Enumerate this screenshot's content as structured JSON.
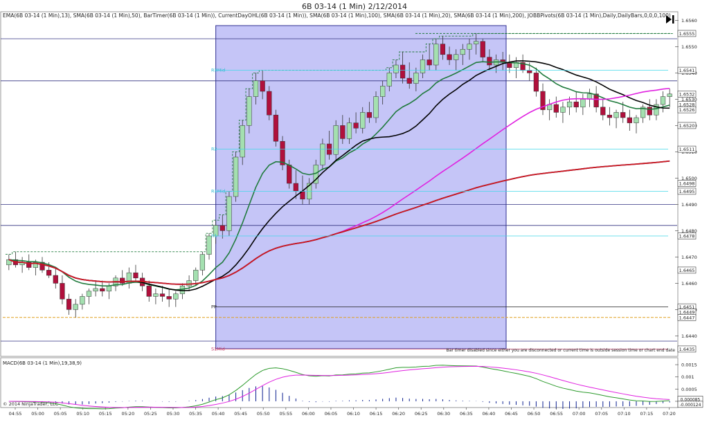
{
  "window": {
    "title": "6B 03-14 (1 Min)  2/12/2014"
  },
  "toolbar": {
    "play_icon": "skip-forward-icon"
  },
  "indicators_label": "EMA(6B 03-14 (1 Min),13), SMA(6B 03-14 (1 Min),50), BarTimer(6B 03-14 (1 Min)), CurrentDayOHL(6B 03-14 (1 Min)), SMA(6B 03-14 (1 Min),100), SMA(6B 03-14 (1 Min),20), SMA(6B 03-14 (1 Min),200), JOBBPivots(6B 03-14 (1 Min),Daily,DailyBars,0,0,0,100)",
  "bar_timer_message": "Bar timer disabled since either you are disconnected or current time is outside session time or chart end date",
  "copyright": "© 2014 NinjaTrader, LLC",
  "macd_label": "MACD(6B 03-14 (1 Min),19,38,9)",
  "colors": {
    "up_candle": "#a4e0b0",
    "down_candle": "#b0103c",
    "ema13": "#1f7a3c",
    "sma20": "#000000",
    "sma50": "#e020e0",
    "sma100": "#0a1ec8",
    "sma200": "#d01818",
    "pivot_line": "#40d8e8",
    "highlight": "#8c8cf0",
    "macd_line": "#2a9a2a",
    "macd_signal": "#e020e0",
    "macd_hist": "#0a1e90"
  },
  "chart_data": [
    {
      "type": "candlestick",
      "title": "6B 03-14 (1 Min)  2/12/2014",
      "x_ticks": [
        "04:55",
        "05:00",
        "05:05",
        "05:10",
        "05:15",
        "05:20",
        "05:25",
        "05:30",
        "05:35",
        "05:40",
        "05:45",
        "05:50",
        "05:55",
        "06:00",
        "06:05",
        "06:10",
        "06:15",
        "06:20",
        "06:25",
        "06:30",
        "06:35",
        "06:40",
        "06:45",
        "06:50",
        "06:55",
        "07:00",
        "07:05",
        "07:10",
        "07:15",
        "07:20"
      ],
      "y_ticks": [
        "1.6440",
        "1.6450",
        "1.6460",
        "1.6470",
        "1.6480",
        "1.6490",
        "1.6500",
        "1.6510",
        "1.6520",
        "1.6530",
        "1.6540",
        "1.6550",
        "1.6560"
      ],
      "ylim": [
        1.6433,
        1.6563
      ],
      "price_labels": [
        "1.6555",
        "1.6541",
        "1.6532",
        "1.6528",
        "1.6526",
        "1.6520",
        "1.6511",
        "1.6498",
        "1.6495",
        "1.6478",
        "1.6465",
        "1.6451",
        "1.6449",
        "1.6447",
        "1.6435"
      ],
      "pivot_levels": [
        {
          "name": "R3Mid",
          "value": 1.6541
        },
        {
          "name": "R2",
          "value": 1.6511
        },
        {
          "name": "R1Mid",
          "value": 1.6495
        },
        {
          "name": "R1",
          "value": 1.6478
        },
        {
          "name": "PP",
          "value": 1.6451
        },
        {
          "name": "S1Mid",
          "value": 1.6435
        }
      ],
      "session_high": 1.6555,
      "session_open": 1.6447,
      "series_names": [
        "EMA 13",
        "SMA 20",
        "SMA 50",
        "SMA 100",
        "SMA 200"
      ],
      "candles": [
        [
          1.6467,
          1.6471,
          1.6465,
          1.6469
        ],
        [
          1.6469,
          1.6472,
          1.6466,
          1.6467
        ],
        [
          1.6467,
          1.647,
          1.6464,
          1.6468
        ],
        [
          1.6468,
          1.6471,
          1.6465,
          1.6466
        ],
        [
          1.6466,
          1.6469,
          1.6463,
          1.6468
        ],
        [
          1.6468,
          1.647,
          1.6464,
          1.6465
        ],
        [
          1.6465,
          1.6468,
          1.6462,
          1.6463
        ],
        [
          1.6463,
          1.6466,
          1.6458,
          1.646
        ],
        [
          1.646,
          1.6463,
          1.6452,
          1.6454
        ],
        [
          1.6454,
          1.6456,
          1.6448,
          1.645
        ],
        [
          1.645,
          1.6454,
          1.6447,
          1.6452
        ],
        [
          1.6452,
          1.6456,
          1.645,
          1.6455
        ],
        [
          1.6455,
          1.6458,
          1.6452,
          1.6457
        ],
        [
          1.6457,
          1.6461,
          1.6455,
          1.6458
        ],
        [
          1.6458,
          1.6461,
          1.6455,
          1.6457
        ],
        [
          1.6457,
          1.646,
          1.6454,
          1.6459
        ],
        [
          1.6459,
          1.6463,
          1.6457,
          1.6462
        ],
        [
          1.6462,
          1.6465,
          1.6459,
          1.646
        ],
        [
          1.646,
          1.6466,
          1.6458,
          1.6464
        ],
        [
          1.6464,
          1.6467,
          1.6461,
          1.6462
        ],
        [
          1.6462,
          1.6464,
          1.6457,
          1.6459
        ],
        [
          1.6459,
          1.6461,
          1.6453,
          1.6455
        ],
        [
          1.6455,
          1.6458,
          1.6452,
          1.6456
        ],
        [
          1.6456,
          1.6459,
          1.6453,
          1.6455
        ],
        [
          1.6455,
          1.6458,
          1.6451,
          1.6454
        ],
        [
          1.6454,
          1.6457,
          1.6451,
          1.6456
        ],
        [
          1.6456,
          1.646,
          1.6454,
          1.6459
        ],
        [
          1.6459,
          1.6463,
          1.6457,
          1.6461
        ],
        [
          1.6461,
          1.6466,
          1.6459,
          1.6465
        ],
        [
          1.6465,
          1.6472,
          1.6463,
          1.6471
        ],
        [
          1.6471,
          1.6479,
          1.6469,
          1.6478
        ],
        [
          1.6478,
          1.6484,
          1.6475,
          1.6482
        ],
        [
          1.6482,
          1.6486,
          1.6477,
          1.648
        ],
        [
          1.648,
          1.6495,
          1.6478,
          1.6493
        ],
        [
          1.6493,
          1.651,
          1.6491,
          1.6508
        ],
        [
          1.6508,
          1.6522,
          1.6505,
          1.652
        ],
        [
          1.652,
          1.6534,
          1.6517,
          1.6531
        ],
        [
          1.6531,
          1.654,
          1.6528,
          1.6537
        ],
        [
          1.6537,
          1.6541,
          1.653,
          1.6533
        ],
        [
          1.6533,
          1.6535,
          1.6522,
          1.6524
        ],
        [
          1.6524,
          1.6526,
          1.6512,
          1.6514
        ],
        [
          1.6514,
          1.6516,
          1.6503,
          1.6505
        ],
        [
          1.6505,
          1.6507,
          1.6496,
          1.6498
        ],
        [
          1.6498,
          1.6503,
          1.6492,
          1.6495
        ],
        [
          1.6495,
          1.6501,
          1.649,
          1.6492
        ],
        [
          1.6492,
          1.65,
          1.649,
          1.6498
        ],
        [
          1.6498,
          1.6507,
          1.6496,
          1.6505
        ],
        [
          1.6505,
          1.6515,
          1.6503,
          1.6513
        ],
        [
          1.6513,
          1.6518,
          1.6507,
          1.6509
        ],
        [
          1.6509,
          1.6522,
          1.6507,
          1.652
        ],
        [
          1.652,
          1.6524,
          1.6513,
          1.6515
        ],
        [
          1.6515,
          1.6523,
          1.6513,
          1.6521
        ],
        [
          1.6521,
          1.6525,
          1.6517,
          1.6519
        ],
        [
          1.6519,
          1.6527,
          1.6517,
          1.6525
        ],
        [
          1.6525,
          1.6529,
          1.6521,
          1.6523
        ],
        [
          1.6523,
          1.6533,
          1.6521,
          1.6531
        ],
        [
          1.6531,
          1.6537,
          1.6528,
          1.6535
        ],
        [
          1.6535,
          1.6542,
          1.6533,
          1.654
        ],
        [
          1.654,
          1.6545,
          1.6538,
          1.6543
        ],
        [
          1.6543,
          1.6548,
          1.6536,
          1.6538
        ],
        [
          1.6538,
          1.6544,
          1.6534,
          1.6536
        ],
        [
          1.6536,
          1.6542,
          1.6533,
          1.654
        ],
        [
          1.654,
          1.6547,
          1.6538,
          1.6545
        ],
        [
          1.6545,
          1.6551,
          1.6541,
          1.6543
        ],
        [
          1.6543,
          1.6553,
          1.6541,
          1.6551
        ],
        [
          1.6551,
          1.6554,
          1.6545,
          1.6547
        ],
        [
          1.6547,
          1.655,
          1.6543,
          1.6545
        ],
        [
          1.6545,
          1.6549,
          1.6541,
          1.6547
        ],
        [
          1.6547,
          1.6551,
          1.6543,
          1.6549
        ],
        [
          1.6549,
          1.6553,
          1.6545,
          1.6551
        ],
        [
          1.6551,
          1.6555,
          1.6547,
          1.6552
        ],
        [
          1.6552,
          1.6553,
          1.6544,
          1.6546
        ],
        [
          1.6546,
          1.6549,
          1.6541,
          1.6543
        ],
        [
          1.6543,
          1.6547,
          1.654,
          1.6545
        ],
        [
          1.6545,
          1.6548,
          1.6541,
          1.6544
        ],
        [
          1.6544,
          1.6547,
          1.654,
          1.6542
        ],
        [
          1.6542,
          1.6546,
          1.6538,
          1.6544
        ],
        [
          1.6544,
          1.6547,
          1.654,
          1.6541
        ],
        [
          1.6541,
          1.6544,
          1.6537,
          1.654
        ],
        [
          1.654,
          1.6542,
          1.6531,
          1.6533
        ],
        [
          1.6533,
          1.6536,
          1.6524,
          1.6526
        ],
        [
          1.6526,
          1.653,
          1.6522,
          1.6528
        ],
        [
          1.6528,
          1.6531,
          1.6523,
          1.6525
        ],
        [
          1.6525,
          1.6529,
          1.6521,
          1.6527
        ],
        [
          1.6527,
          1.6531,
          1.6524,
          1.6529
        ],
        [
          1.6529,
          1.6533,
          1.6525,
          1.6527
        ],
        [
          1.6527,
          1.6532,
          1.6524,
          1.653
        ],
        [
          1.653,
          1.6534,
          1.6527,
          1.6532
        ],
        [
          1.6532,
          1.6535,
          1.6525,
          1.6527
        ],
        [
          1.6527,
          1.653,
          1.6522,
          1.6524
        ],
        [
          1.6524,
          1.6527,
          1.652,
          1.6523
        ],
        [
          1.6523,
          1.6526,
          1.6519,
          1.6525
        ],
        [
          1.6525,
          1.6529,
          1.6521,
          1.6523
        ],
        [
          1.6523,
          1.6526,
          1.6518,
          1.6521
        ],
        [
          1.6521,
          1.6524,
          1.6517,
          1.6523
        ],
        [
          1.6523,
          1.6528,
          1.6521,
          1.6527
        ],
        [
          1.6527,
          1.653,
          1.6522,
          1.6524
        ],
        [
          1.6524,
          1.653,
          1.6522,
          1.6528
        ],
        [
          1.6528,
          1.6533,
          1.6525,
          1.6531
        ],
        [
          1.6531,
          1.6534,
          1.6527,
          1.6532
        ]
      ]
    },
    {
      "type": "line",
      "title": "MACD(6B 03-14 (1 Min),19,38,9)",
      "y_ticks": [
        "0.0015",
        "0.001",
        "0.0005",
        "0"
      ],
      "ylim": [
        -0.0002,
        0.0017
      ],
      "price_labels": [
        "0.000085",
        "-0.000124"
      ]
    }
  ]
}
